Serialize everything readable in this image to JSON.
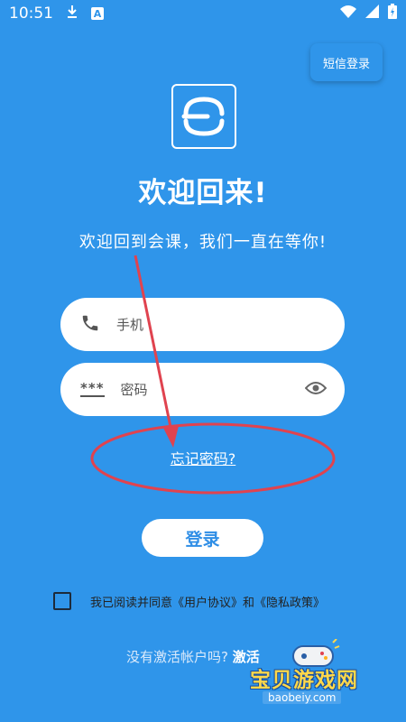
{
  "status_bar": {
    "time": "10:51",
    "indicator_a": "A"
  },
  "header": {
    "sms_login_label": "短信登录"
  },
  "welcome": {
    "title": "欢迎回来!",
    "subtitle": "欢迎回到会课，我们一直在等你!"
  },
  "form": {
    "phone_placeholder": "手机",
    "password_placeholder": "密码",
    "password_mask_icon": "***",
    "forgot_password": "忘记密码?",
    "login_label": "登录"
  },
  "agreement": {
    "prefix": "我已阅读并同意",
    "user_agreement": "《用户协议》",
    "and": "和",
    "privacy_policy": "《隐私政策》",
    "checked": false
  },
  "activation": {
    "question": "没有激活帐户吗?",
    "action": "激活"
  },
  "watermark": {
    "name": "宝贝游戏网",
    "url": "baobeiy.com"
  },
  "colors": {
    "background": "#2f95ea",
    "annotation": "#e0434f",
    "login_text": "#2f8ee6"
  },
  "icons": {
    "download": "download-icon",
    "notification": "notification-a-icon",
    "wifi": "wifi-icon",
    "signal": "signal-icon",
    "battery": "battery-charging-icon",
    "phone": "phone-icon",
    "password": "password-mask-icon",
    "visibility": "eye-icon"
  }
}
